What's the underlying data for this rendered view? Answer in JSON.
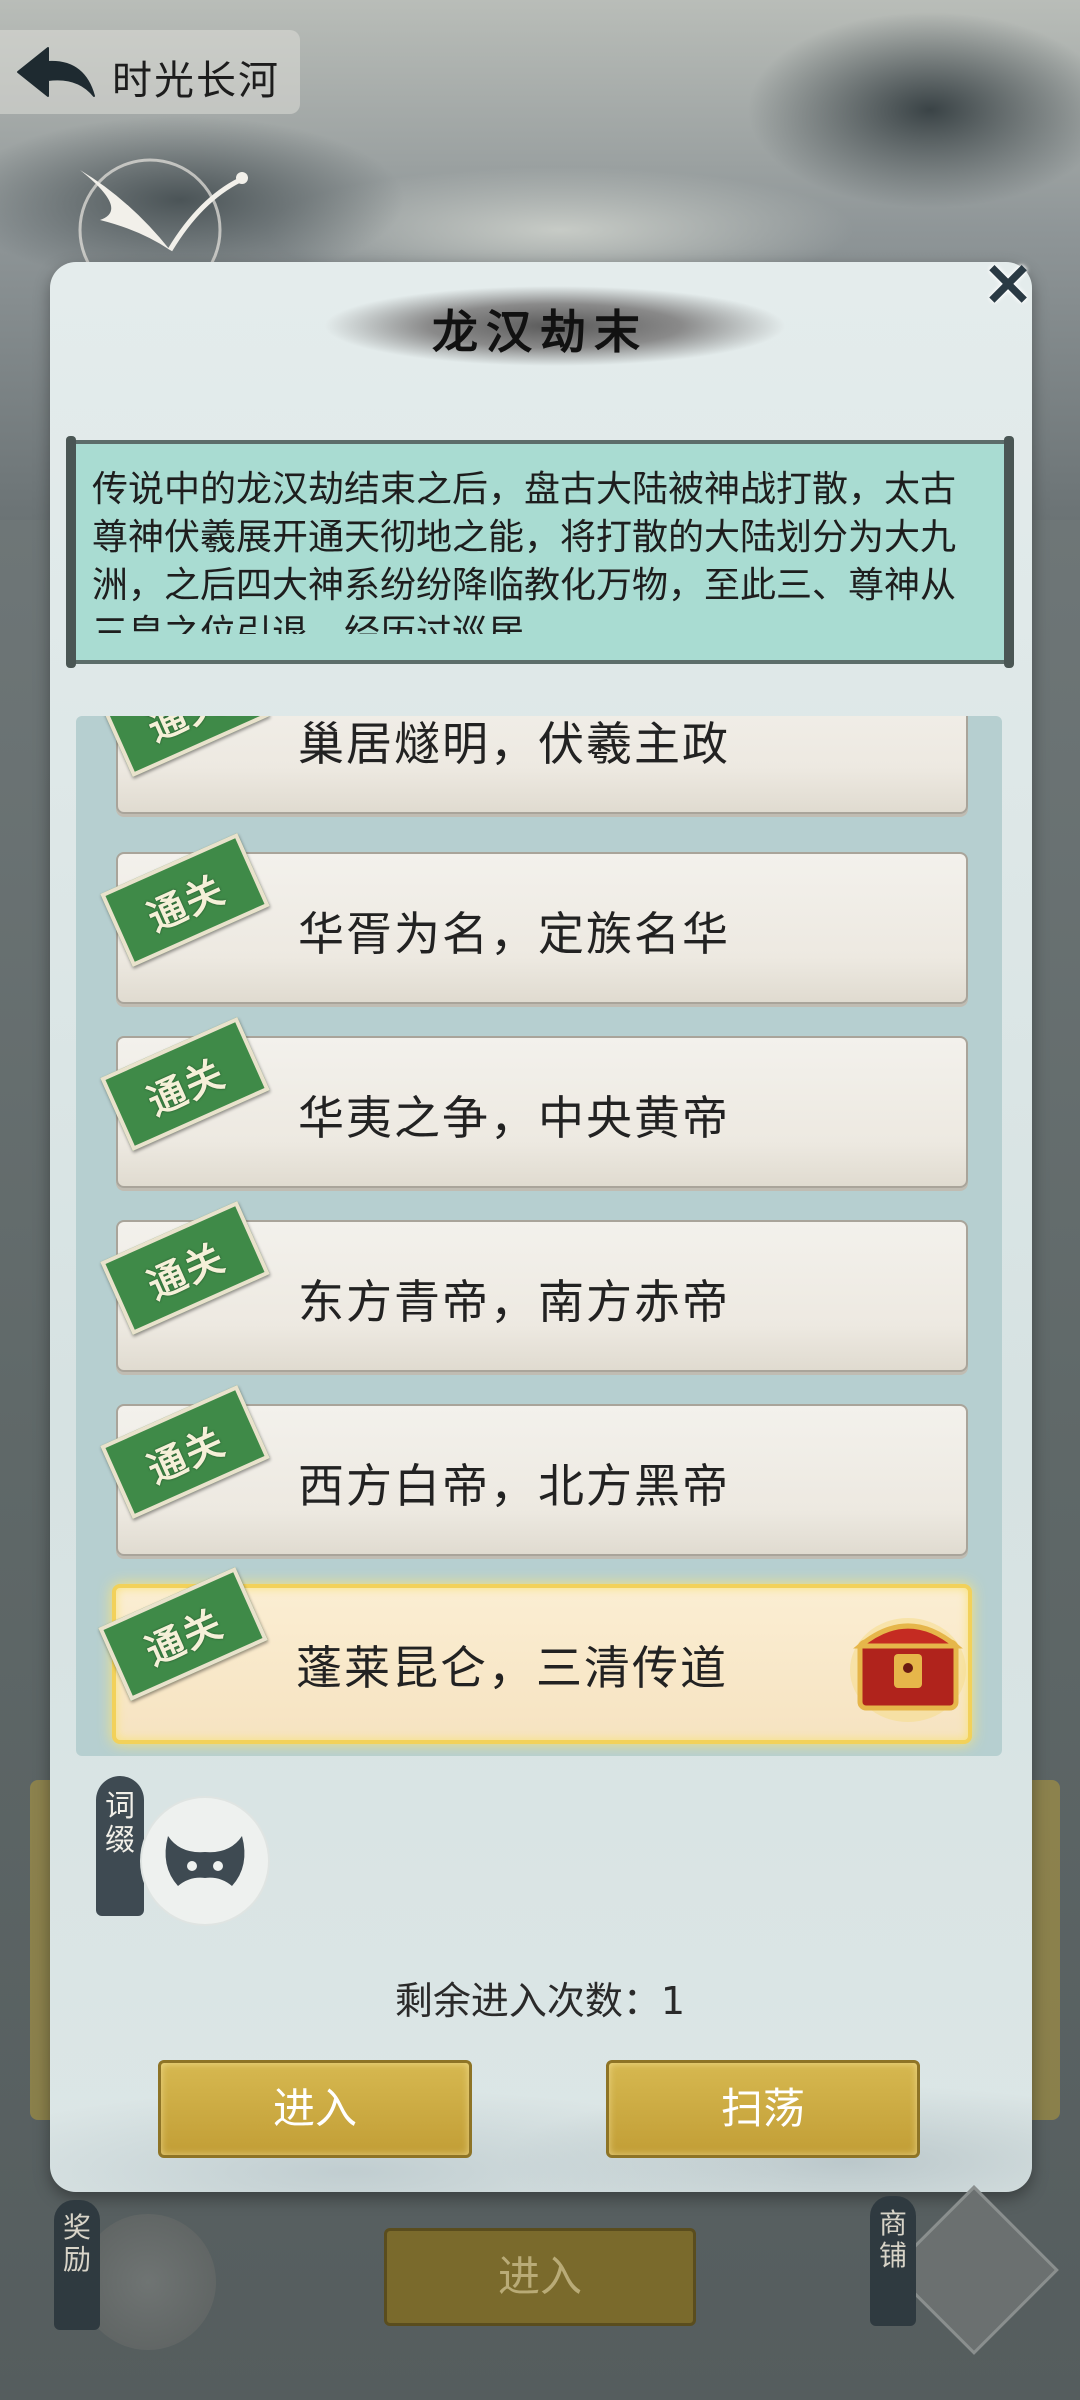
{
  "header": {
    "title": "时光长河"
  },
  "modal": {
    "title": "龙汉劫末",
    "close_label": "×",
    "story": "传说中的龙汉劫结束之后，盘古大陆被神战打散，太古尊神伏羲展开通天彻地之能，将打散的大陆划分为大九洲，之后四大神系纷纷降临教化万物，至此三、尊神从三皇之位引退，经历过巡居",
    "stages": [
      {
        "label": "巢居燧明，伏羲主政",
        "badge": "通关",
        "selected": false
      },
      {
        "label": "华胥为名，定族名华",
        "badge": "通关",
        "selected": false
      },
      {
        "label": "华夷之争，中央黄帝",
        "badge": "通关",
        "selected": false
      },
      {
        "label": "东方青帝，南方赤帝",
        "badge": "通关",
        "selected": false
      },
      {
        "label": "西方白帝，北方黑帝",
        "badge": "通关",
        "selected": false
      },
      {
        "label": "蓬莱昆仑，三清传道",
        "badge": "通关",
        "selected": true,
        "has_chest": true
      }
    ],
    "affix_label": "词缀",
    "remaining": "剩余进入次数：1",
    "enter_label": "进入",
    "sweep_label": "扫荡"
  },
  "background": {
    "enter_label": "进入",
    "reward_label": "奖励",
    "shop_label": "商铺"
  },
  "colors": {
    "badge_green": "#3f8a48",
    "gold_button": "#c9a842",
    "scroll_teal": "#a9dcd2",
    "selected_glow": "#f2d15a"
  }
}
